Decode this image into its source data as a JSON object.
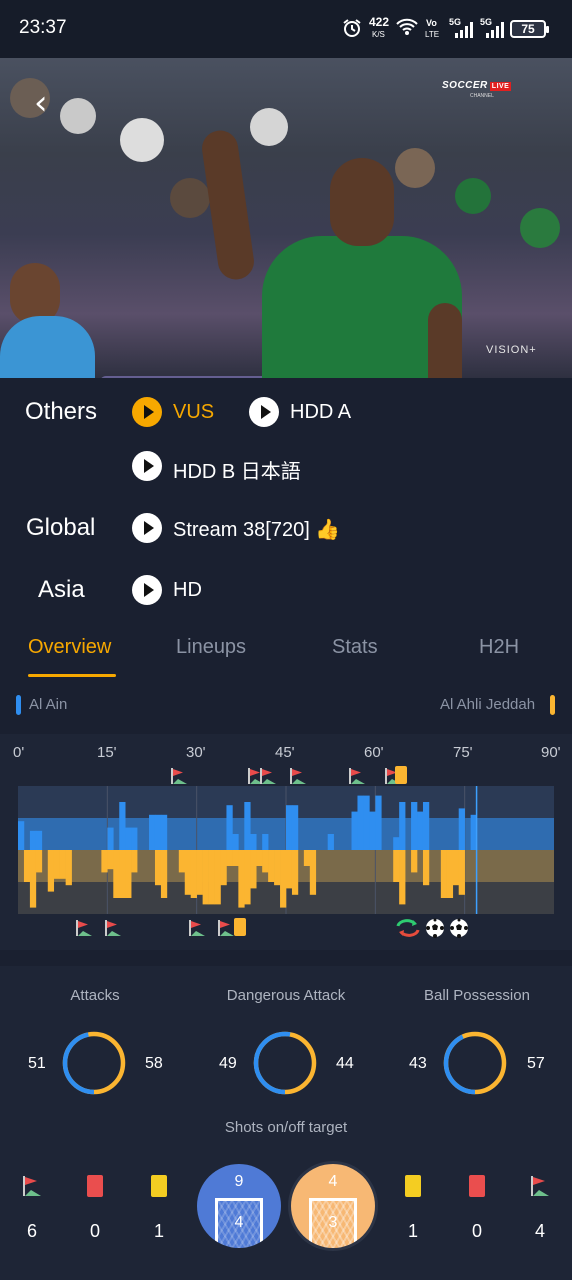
{
  "status_bar": {
    "time": "23:37",
    "net_speed_value": "422",
    "net_speed_unit": "K/S",
    "volte_top": "Vo",
    "volte_bottom": "LTE",
    "sim1": "5G",
    "sim2": "5G",
    "battery": "75"
  },
  "video": {
    "channel_logo": "SOCCER",
    "channel_live": "LIVE",
    "channel_sub": "CHANNEL",
    "watermark": "VISION+"
  },
  "streams": [
    {
      "category": "Others",
      "items": [
        {
          "label": "VUS",
          "active": true
        },
        {
          "label": "HDD A",
          "active": false
        }
      ]
    },
    {
      "category": "",
      "items": [
        {
          "label": "HDD B 日本語",
          "active": false
        }
      ]
    },
    {
      "category": "Global",
      "items": [
        {
          "label": "Stream 38[720] 👍",
          "active": false
        }
      ]
    },
    {
      "category": "Asia",
      "items": [
        {
          "label": "HD",
          "active": false
        }
      ]
    }
  ],
  "tabs": [
    "Overview",
    "Lineups",
    "Stats",
    "H2H"
  ],
  "active_tab": "Overview",
  "teams": {
    "home": {
      "name": "Al Ain",
      "color": "#2f8ef0"
    },
    "away": {
      "name": "Al Ahli Jeddah",
      "color": "#fbb531"
    }
  },
  "timeline": {
    "minute_labels": [
      "0'",
      "15'",
      "30'",
      "45'",
      "60'",
      "75'",
      "90'"
    ],
    "current_minute": 77
  },
  "chart_data": {
    "type": "bar",
    "x_label_ticks": [
      "0'",
      "15'",
      "30'",
      "45'",
      "60'",
      "75'",
      "90'"
    ],
    "xlim": [
      0,
      90
    ],
    "ylim": [
      0,
      1
    ],
    "series": [
      {
        "name": "Al Ain",
        "color": "#2f8ef0",
        "values": [
          0.45,
          0,
          0.3,
          0.3,
          0,
          0,
          0,
          0,
          0,
          0,
          0,
          0,
          0,
          0,
          0,
          0.35,
          0,
          0.75,
          0.35,
          0.35,
          0,
          0,
          0.55,
          0.55,
          0.55,
          0,
          0,
          0,
          0,
          0,
          0,
          0,
          0,
          0,
          0,
          0.7,
          0.25,
          0,
          0.75,
          0.25,
          0,
          0.25,
          0,
          0,
          0,
          0.7,
          0.7,
          0,
          0,
          0,
          0,
          0,
          0.25,
          0,
          0,
          0,
          0.6,
          0.85,
          0.85,
          0.6,
          0.85,
          0,
          0,
          0.2,
          0.75,
          0,
          0.75,
          0.6,
          0.75,
          0,
          0,
          0,
          0,
          0,
          0.65,
          0,
          0.55,
          0,
          0,
          0,
          0,
          0,
          0,
          0,
          0,
          0,
          0,
          0,
          0,
          0,
          0
        ]
      },
      {
        "name": "Al Ahli Jeddah",
        "color": "#fbb531",
        "values": [
          0,
          0.5,
          0.9,
          0.35,
          0,
          0.65,
          0.45,
          0.45,
          0.55,
          0,
          0,
          0,
          0,
          0,
          0.35,
          0.3,
          0.75,
          0.75,
          0.75,
          0.35,
          0,
          0,
          0,
          0.55,
          0.75,
          0,
          0,
          0.35,
          0.7,
          0.75,
          0.7,
          0.85,
          0.85,
          0.85,
          0.55,
          0.25,
          0.25,
          0.9,
          0.85,
          0.6,
          0.25,
          0.35,
          0.5,
          0.55,
          0.9,
          0.6,
          0.7,
          0,
          0.25,
          0.7,
          0,
          0,
          0,
          0,
          0,
          0,
          0,
          0,
          0,
          0,
          0,
          0,
          0,
          0.5,
          0.85,
          0,
          0.35,
          0,
          0.55,
          0,
          0,
          0.75,
          0.75,
          0.55,
          0.7,
          0,
          0,
          0,
          0,
          0,
          0,
          0,
          0,
          0,
          0,
          0,
          0,
          0,
          0,
          0,
          0
        ]
      }
    ]
  },
  "events_top": [
    {
      "minute": 27,
      "icon": "corner-flag-icon"
    },
    {
      "minute": 40,
      "icon": "corner-flag-icon"
    },
    {
      "minute": 42,
      "icon": "corner-flag-icon"
    },
    {
      "minute": 47,
      "icon": "corner-flag-icon"
    },
    {
      "minute": 57,
      "icon": "corner-flag-icon"
    },
    {
      "minute": 63,
      "icon": "corner-flag-icon"
    },
    {
      "minute": 65,
      "icon": "yellow-card-icon"
    }
  ],
  "events_bottom": [
    {
      "minute": 11,
      "icon": "corner-flag-icon"
    },
    {
      "minute": 16,
      "icon": "corner-flag-icon"
    },
    {
      "minute": 30,
      "icon": "corner-flag-icon"
    },
    {
      "minute": 35,
      "icon": "corner-flag-icon"
    },
    {
      "minute": 38,
      "icon": "yellow-card-icon"
    },
    {
      "minute": 65,
      "icon": "substitution-icon"
    },
    {
      "minute": 70,
      "icon": "goal-ball-icon"
    },
    {
      "minute": 74,
      "icon": "goal-ball-icon"
    }
  ],
  "stats": [
    {
      "title": "Attacks",
      "home": "51",
      "away": "58",
      "home_share": 0.468
    },
    {
      "title": "Dangerous Attack",
      "home": "49",
      "away": "44",
      "home_share": 0.527
    },
    {
      "title": "Ball Possession",
      "home": "43",
      "away": "57",
      "home_share": 0.43
    }
  ],
  "shots": {
    "title": "Shots on/off target",
    "home": {
      "on": "9",
      "off": "4",
      "corners": "6",
      "red": "0",
      "yellow": "1"
    },
    "away": {
      "on": "4",
      "off": "3",
      "corners": "4",
      "red": "0",
      "yellow": "1"
    }
  }
}
